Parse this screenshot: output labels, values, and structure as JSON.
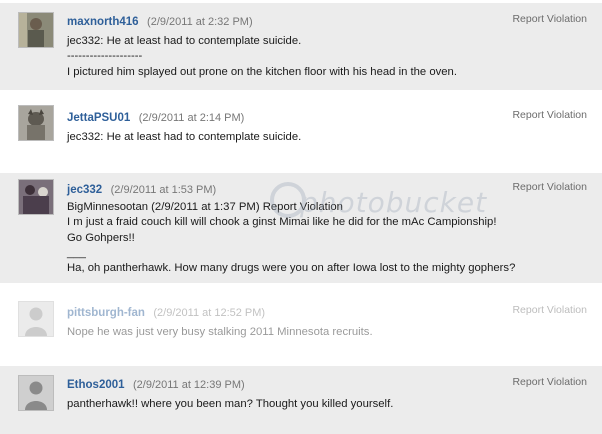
{
  "comments": [
    {
      "author": "maxnorth416",
      "timestamp": "(2/9/2011 at 2:32 PM)",
      "report": "Report Violation",
      "lines": [
        "jec332: He at least had to contemplate suicide.",
        "--------------------",
        "I pictured him splayed out prone on the kitchen floor with his head in the oven."
      ]
    },
    {
      "author": "JettaPSU01",
      "timestamp": "(2/9/2011 at 2:14 PM)",
      "report": "Report Violation",
      "lines": [
        "jec332: He at least had to contemplate suicide."
      ]
    },
    {
      "author": "jec332",
      "timestamp": "(2/9/2011 at 1:53 PM)",
      "report": "Report Violation",
      "lines": [
        "BigMinnesootan (2/9/2011 at 1:37 PM) Report Violation",
        "I m just a fraid couch kill will chook a ginst Mimai like he did for the mAc Campionship!",
        "Go Gohpers!!",
        "___",
        "Ha, oh pantherhawk. How many drugs were you on after Iowa lost to the mighty gophers?"
      ]
    },
    {
      "author": "pittsburgh-fan",
      "timestamp": "(2/9/2011 at 12:52 PM)",
      "report": "Report Violation",
      "lines": [
        "Nope he was just very busy stalking 2011 Minnesota recruits."
      ]
    },
    {
      "author": "Ethos2001",
      "timestamp": "(2/9/2011 at 12:39 PM)",
      "report": "Report Violation",
      "lines": [
        "pantherhawk!! where you been man? Thought you killed yourself."
      ]
    }
  ],
  "watermark": {
    "text": "photobucket"
  }
}
